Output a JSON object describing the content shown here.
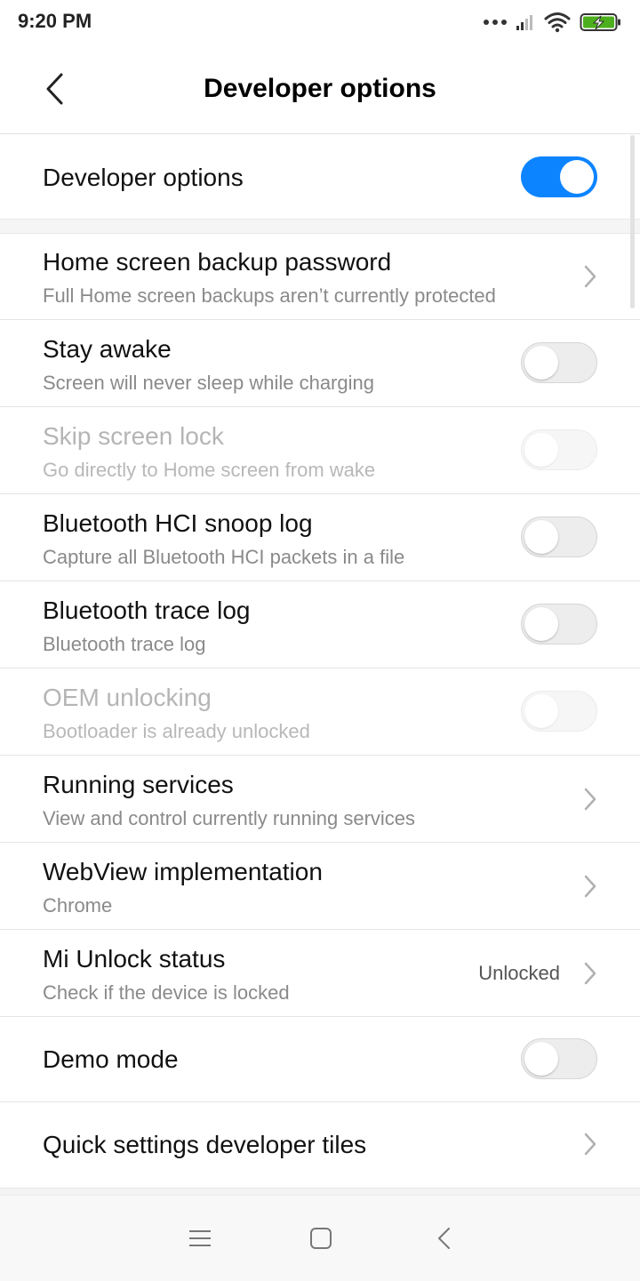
{
  "status_bar": {
    "time": "9:20 PM",
    "icons": [
      "dots-icon",
      "signal-icon",
      "wifi-icon",
      "battery-charging-icon"
    ],
    "battery_color": "#4caf1e"
  },
  "header": {
    "title": "Developer options",
    "back_icon": "back-arrow-icon"
  },
  "master": {
    "label": "Developer options",
    "enabled": true
  },
  "accent_color": "#0d84ff",
  "settings": [
    {
      "title": "Home screen backup password",
      "subtitle": "Full Home screen backups aren’t currently protected",
      "control": "chevron"
    },
    {
      "title": "Stay awake",
      "subtitle": "Screen will never sleep while charging",
      "control": "toggle",
      "state": "off"
    },
    {
      "title": "Skip screen lock",
      "subtitle": "Go directly to Home screen from wake",
      "control": "toggle",
      "state": "disabled"
    },
    {
      "title": "Bluetooth HCI snoop log",
      "subtitle": "Capture all Bluetooth HCI packets in a file",
      "control": "toggle",
      "state": "off"
    },
    {
      "title": "Bluetooth trace log",
      "subtitle": "Bluetooth trace log",
      "control": "toggle",
      "state": "off"
    },
    {
      "title": "OEM unlocking",
      "subtitle": "Bootloader is already unlocked",
      "control": "toggle",
      "state": "disabled"
    },
    {
      "title": "Running services",
      "subtitle": "View and control currently running services",
      "control": "chevron"
    },
    {
      "title": "WebView implementation",
      "subtitle": "Chrome",
      "control": "chevron"
    },
    {
      "title": "Mi Unlock status",
      "subtitle": "Check if the device is locked",
      "control": "chevron",
      "value": "Unlocked"
    },
    {
      "title": "Demo mode",
      "control": "toggle",
      "state": "off"
    },
    {
      "title": "Quick settings developer tiles",
      "control": "chevron"
    }
  ],
  "nav_bar": {
    "buttons": [
      "menu-icon",
      "home-icon",
      "back-icon"
    ]
  }
}
